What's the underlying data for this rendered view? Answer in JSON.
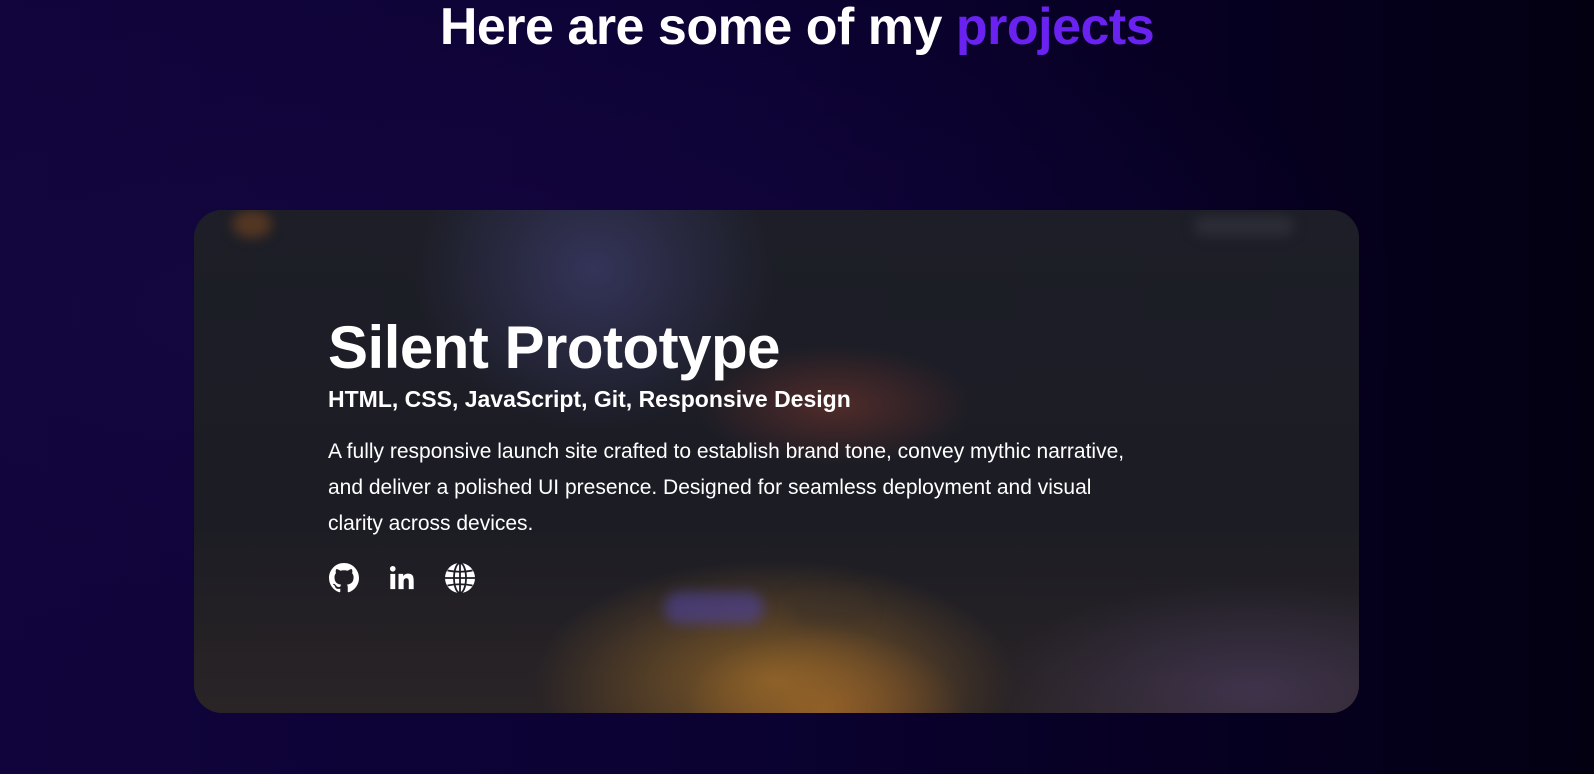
{
  "heading": {
    "prefix": "Here are some of my",
    "accent": "projects",
    "accent_color": "#6a22f0"
  },
  "project": {
    "title": "Silent Prototype",
    "tech_stack": "HTML, CSS, JavaScript, Git, Responsive Design",
    "description": "A fully responsive launch site crafted to establish brand tone, convey mythic narrative, and deliver a polished UI presence. Designed for seamless deployment and visual clarity across devices.",
    "links": [
      {
        "icon": "github-icon"
      },
      {
        "icon": "linkedin-icon"
      },
      {
        "icon": "globe-icon"
      }
    ]
  }
}
